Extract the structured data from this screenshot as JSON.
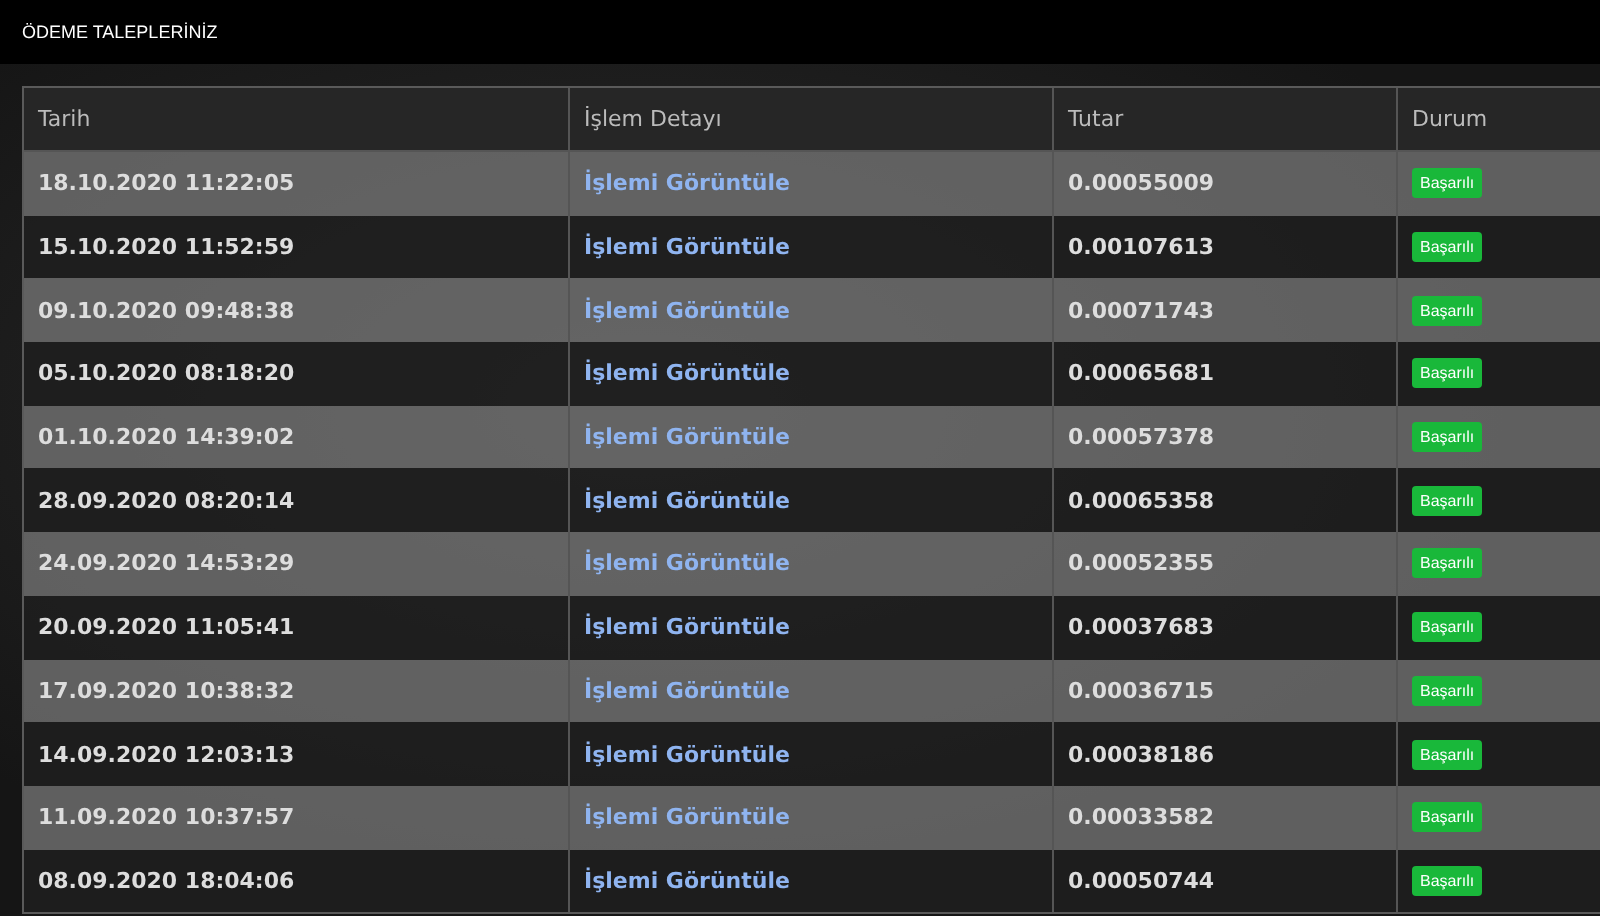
{
  "title": "ÖDEME TALEPLERİNİZ",
  "table": {
    "columns": [
      "Tarih",
      "İşlem Detayı",
      "Tutar",
      "Durum"
    ],
    "rows": [
      {
        "date": "18.10.2020 11:22:05",
        "link": "İşlemi Görüntüle",
        "amount": "0.00055009",
        "status": "Başarılı"
      },
      {
        "date": "15.10.2020 11:52:59",
        "link": "İşlemi Görüntüle",
        "amount": "0.00107613",
        "status": "Başarılı"
      },
      {
        "date": "09.10.2020 09:48:38",
        "link": "İşlemi Görüntüle",
        "amount": "0.00071743",
        "status": "Başarılı"
      },
      {
        "date": "05.10.2020 08:18:20",
        "link": "İşlemi Görüntüle",
        "amount": "0.00065681",
        "status": "Başarılı"
      },
      {
        "date": "01.10.2020 14:39:02",
        "link": "İşlemi Görüntüle",
        "amount": "0.00057378",
        "status": "Başarılı"
      },
      {
        "date": "28.09.2020 08:20:14",
        "link": "İşlemi Görüntüle",
        "amount": "0.00065358",
        "status": "Başarılı"
      },
      {
        "date": "24.09.2020 14:53:29",
        "link": "İşlemi Görüntüle",
        "amount": "0.00052355",
        "status": "Başarılı"
      },
      {
        "date": "20.09.2020 11:05:41",
        "link": "İşlemi Görüntüle",
        "amount": "0.00037683",
        "status": "Başarılı"
      },
      {
        "date": "17.09.2020 10:38:32",
        "link": "İşlemi Görüntüle",
        "amount": "0.00036715",
        "status": "Başarılı"
      },
      {
        "date": "14.09.2020 12:03:13",
        "link": "İşlemi Görüntüle",
        "amount": "0.00038186",
        "status": "Başarılı"
      },
      {
        "date": "11.09.2020 10:37:57",
        "link": "İşlemi Görüntüle",
        "amount": "0.00033582",
        "status": "Başarılı"
      },
      {
        "date": "08.09.2020 18:04:06",
        "link": "İşlemi Görüntüle",
        "amount": "0.00050744",
        "status": "Başarılı"
      }
    ]
  }
}
